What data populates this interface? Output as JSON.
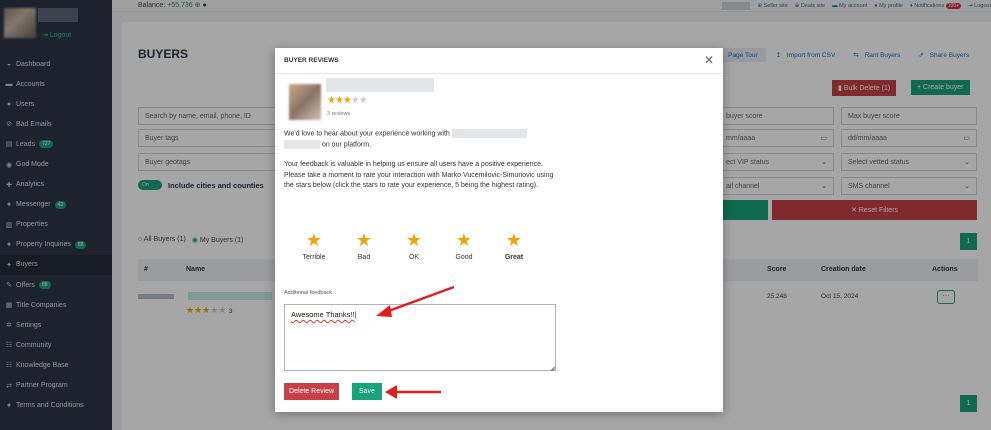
{
  "colors": {
    "accent_green": "#1aa37c",
    "danger_red": "#c64147",
    "sidebar_bg": "#2b3646",
    "star": "#f0a30a"
  },
  "sidebar": {
    "logout": "Logout",
    "items": [
      {
        "label": "Dashboard",
        "icon": "dashboard-icon",
        "glyph": "◒"
      },
      {
        "label": "Accounts",
        "icon": "accounts-icon",
        "glyph": "▬"
      },
      {
        "label": "Users",
        "icon": "user-icon",
        "glyph": "●"
      },
      {
        "label": "Bad Emails",
        "icon": "ban-icon",
        "glyph": "⊘"
      },
      {
        "label": "Leads",
        "icon": "leads-icon",
        "glyph": "▤",
        "badge": "727"
      },
      {
        "label": "God Mode",
        "icon": "godmode-icon",
        "glyph": "◉"
      },
      {
        "label": "Analytics",
        "icon": "analytics-icon",
        "glyph": "✚"
      },
      {
        "label": "Messenger",
        "icon": "messenger-icon",
        "glyph": "●",
        "badge": "43"
      },
      {
        "label": "Properties",
        "icon": "properties-icon",
        "glyph": "▥"
      },
      {
        "label": "Property Inquiries",
        "icon": "inquiries-icon",
        "glyph": "●",
        "badge": "88"
      },
      {
        "label": "Buyers",
        "icon": "buyers-icon",
        "glyph": "✦",
        "active": true
      },
      {
        "label": "Offers",
        "icon": "offers-icon",
        "glyph": "✎",
        "badge": "88"
      },
      {
        "label": "Title Companies",
        "icon": "title-companies-icon",
        "glyph": "▦"
      },
      {
        "label": "Settings",
        "icon": "settings-icon",
        "glyph": "✲"
      },
      {
        "label": "Community",
        "icon": "community-icon",
        "glyph": "☷"
      },
      {
        "label": "Knowledge Base",
        "icon": "knowledge-base-icon",
        "glyph": "☷"
      },
      {
        "label": "Partner Program",
        "icon": "partner-icon",
        "glyph": "⇄"
      },
      {
        "label": "Terms and Conditions",
        "icon": "terms-icon",
        "glyph": "●"
      }
    ]
  },
  "topbar": {
    "balance_label": "Balance:",
    "balance_value": "+55.736",
    "links": {
      "seller": "Seller site",
      "deals": "Deals site",
      "account": "My account",
      "profile": "My profile",
      "notifications": "Notifications",
      "notif_count": "100+",
      "logout": "Logout"
    }
  },
  "page": {
    "title": "BUYERS",
    "page_tour": "Page Tour",
    "import_csv": "Import from CSV",
    "rant_buyers": "Rant Buyers",
    "share_buyers": "Share Buyers",
    "bulk_delete": "Bulk Delete (1)",
    "create_buyer": "+ Create buyer",
    "search_placeholder": "Search by name, email, phone, ID",
    "tags_placeholder": "Buyer tags",
    "geotags_placeholder": "Buyer geotags",
    "include_cities": "Include cities and counties",
    "toggle_on": "On",
    "min_score": "buyer score",
    "max_score": "Max buyer score",
    "date_from": "mm/aaaa",
    "date_to": "dd/mm/aaaa",
    "vip": "ect VIP status",
    "vetted": "Select vetted status",
    "email_channel": "ail channel",
    "sms_channel": "SMS channel",
    "reset_filters": "✕ Reset Filters",
    "all_buyers": "All Buyers (1)",
    "my_buyers": "My Buyers (1)",
    "page_num": "1",
    "columns": {
      "hash": "#",
      "name": "Name",
      "score": "Score",
      "created": "Creation date",
      "actions": "Actions"
    },
    "row": {
      "score": "25.248",
      "created": "Oct 15, 2024",
      "stars_count": "3"
    }
  },
  "modal": {
    "title": "BUYER REVIEWS",
    "close": "✕",
    "reviews_count": "3 reviews",
    "intro_a": "We'd love to hear about your experience working with",
    "intro_b": "on our platform.",
    "body": "Your feedback is valuable in helping us ensure all users have a positive experience. Please take a moment to rate your interaction with Marko Vucemilovic-Simunovic using the stars below (click the stars to rate your experience, 5 being the highest rating).",
    "ratings": [
      "Terrible",
      "Bad",
      "OK",
      "Good",
      "Great"
    ],
    "selected_rating": 5,
    "feedback_label": "Additional feedback",
    "feedback_value": "Awesome Thanks!!",
    "delete_label": "Delete Review",
    "save_label": "Save"
  }
}
